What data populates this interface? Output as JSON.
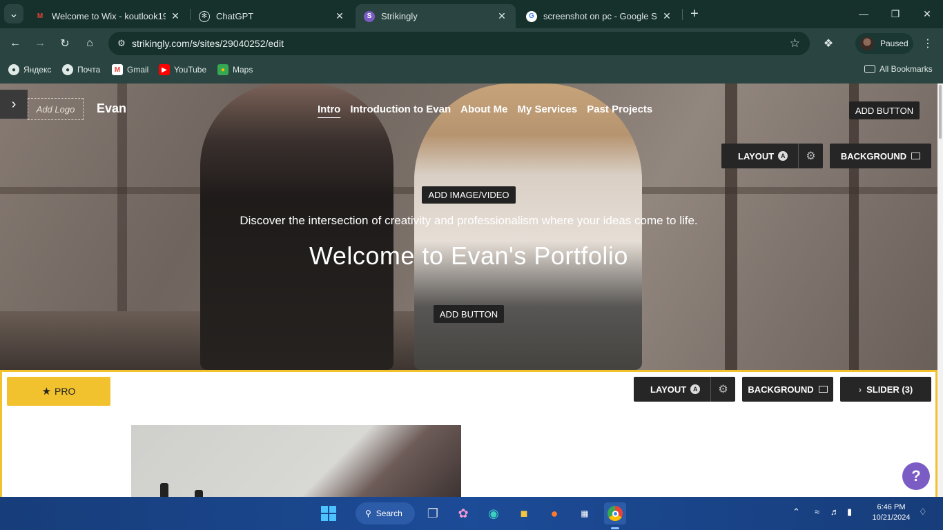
{
  "browser": {
    "tabs": [
      {
        "title": "Welcome to Wix - koutlook19@",
        "icon": "gmail-icon"
      },
      {
        "title": "ChatGPT",
        "icon": "chatgpt-icon"
      },
      {
        "title": "Strikingly",
        "icon": "strikingly-icon",
        "active": true
      },
      {
        "title": "screenshot on pc - Google Sear",
        "icon": "google-icon"
      }
    ],
    "url": "strikingly.com/s/sites/29040252/edit",
    "profile_label": "Paused",
    "bookmarks": [
      {
        "label": "Яндекс",
        "icon": "globe-icon"
      },
      {
        "label": "Почта",
        "icon": "globe-icon"
      },
      {
        "label": "Gmail",
        "icon": "gmail-icon"
      },
      {
        "label": "YouTube",
        "icon": "youtube-icon"
      },
      {
        "label": "Maps",
        "icon": "maps-icon"
      }
    ],
    "all_bookmarks": "All Bookmarks"
  },
  "site": {
    "add_logo": "Add Logo",
    "brand": "Evan",
    "nav": [
      "Intro",
      "Introduction to Evan",
      "About Me",
      "My Services",
      "Past Projects"
    ],
    "header_add_button": "ADD BUTTON",
    "layout_label": "LAYOUT",
    "layout_badge": "A",
    "background_label": "BACKGROUND",
    "add_media": "ADD IMAGE/VIDEO",
    "tagline": "Discover the intersection of creativity and professionalism where your ideas come to life.",
    "headline": "Welcome to Evan's Portfolio",
    "hero_add_button": "ADD BUTTON"
  },
  "section2": {
    "pro_label": "PRO",
    "layout_label": "LAYOUT",
    "layout_badge": "A",
    "background_label": "BACKGROUND",
    "slider_label": "SLIDER (3)"
  },
  "help_label": "?",
  "taskbar": {
    "search_label": "Search",
    "time": "6:46 PM",
    "date": "10/21/2024"
  },
  "colors": {
    "accent": "#f2c12e",
    "help": "#7b5cc4",
    "chrome_bg": "#2a4541"
  }
}
